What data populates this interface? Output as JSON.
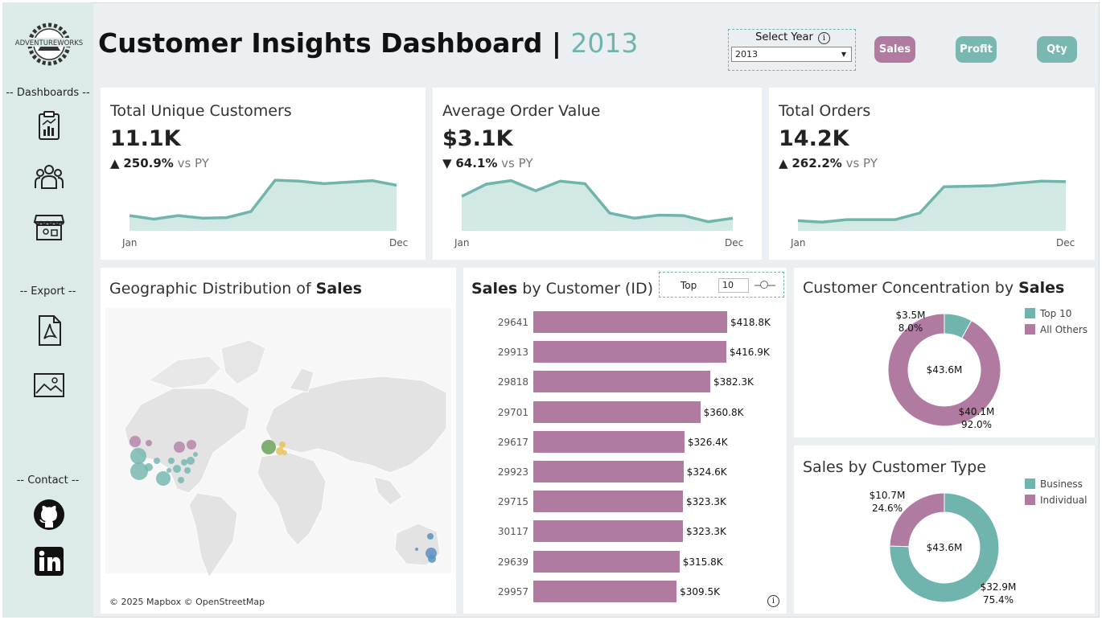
{
  "app": {
    "logo_text": "ADVENTUREWORKS",
    "title": "Customer Insights Dashboard |",
    "year": "2013"
  },
  "sidebar": {
    "dashboards_label": "-- Dashboards --",
    "export_label": "-- Export --",
    "contact_label": "-- Contact --",
    "icons": [
      "report-icon",
      "customers-icon",
      "store-icon",
      "pdf-icon",
      "image-icon",
      "github-icon",
      "linkedin-icon"
    ]
  },
  "filter": {
    "label": "Select Year",
    "value": "2013"
  },
  "measures": {
    "sales": "Sales",
    "profit": "Profit",
    "qty": "Qty"
  },
  "colors": {
    "teal": "#6fb5ad",
    "mauve": "#b07aa1",
    "active_pill": "#b07aa1"
  },
  "kpis": [
    {
      "title": "Total Unique Customers",
      "value": "11.1K",
      "arrow": "▲",
      "delta": "250.9%",
      "vs": "vs PY",
      "start": "Jan",
      "end": "Dec",
      "chart_data": {
        "type": "area",
        "x": [
          "Jan",
          "Feb",
          "Mar",
          "Apr",
          "May",
          "Jun",
          "Jul",
          "Aug",
          "Sep",
          "Oct",
          "Nov",
          "Dec"
        ],
        "values": [
          0.3,
          0.23,
          0.3,
          0.25,
          0.26,
          0.38,
          1.0,
          0.98,
          0.93,
          0.96,
          0.99,
          0.9
        ]
      }
    },
    {
      "title": "Average Order Value",
      "value": "$3.1K",
      "arrow": "▼",
      "delta": "64.1%",
      "vs": "vs PY",
      "start": "Jan",
      "end": "Dec",
      "chart_data": {
        "type": "area",
        "x": [
          "Jan",
          "Feb",
          "Mar",
          "Apr",
          "May",
          "Jun",
          "Jul",
          "Aug",
          "Sep",
          "Oct",
          "Nov",
          "Dec"
        ],
        "values": [
          0.68,
          0.92,
          0.99,
          0.79,
          0.98,
          0.93,
          0.35,
          0.25,
          0.31,
          0.3,
          0.18,
          0.25
        ]
      }
    },
    {
      "title": "Total Orders",
      "value": "14.2K",
      "arrow": "▲",
      "delta": "262.2%",
      "vs": "vs PY",
      "start": "Jan",
      "end": "Dec",
      "chart_data": {
        "type": "area",
        "x": [
          "Jan",
          "Feb",
          "Mar",
          "Apr",
          "May",
          "Jun",
          "Jul",
          "Aug",
          "Sep",
          "Oct",
          "Nov",
          "Dec"
        ],
        "values": [
          0.2,
          0.17,
          0.22,
          0.22,
          0.22,
          0.35,
          0.87,
          0.88,
          0.89,
          0.94,
          0.98,
          0.97
        ]
      }
    }
  ],
  "map": {
    "title_pre": "Geographic Distribution of ",
    "title_bold": "Sales",
    "attribution": "© 2025 Mapbox  © OpenStreetMap"
  },
  "bars": {
    "title_bold": "Sales",
    "title_rest": " by Customer (ID)",
    "top_label": "Top",
    "top_value": "10",
    "chart_data": {
      "type": "bar",
      "categories": [
        "29641",
        "29913",
        "29818",
        "29701",
        "29617",
        "29923",
        "29715",
        "30117",
        "29639",
        "29957"
      ],
      "values": [
        418.8,
        416.9,
        382.3,
        360.8,
        326.4,
        324.6,
        323.3,
        323.3,
        315.8,
        309.5
      ],
      "labels": [
        "$418.8K",
        "$416.9K",
        "$382.3K",
        "$360.8K",
        "$326.4K",
        "$324.6K",
        "$323.3K",
        "$323.3K",
        "$315.8K",
        "$309.5K"
      ]
    }
  },
  "concentration": {
    "title_pre": "Customer Concentration by ",
    "title_bold": "Sales",
    "center": "$43.6M",
    "chart_data": {
      "type": "pie",
      "series": [
        {
          "name": "Top 10",
          "value": 3.5,
          "label": "$3.5M",
          "pct": "8.0%",
          "color": "#6fb5ad"
        },
        {
          "name": "All Others",
          "value": 40.1,
          "label": "$40.1M",
          "pct": "92.0%",
          "color": "#b07aa1"
        }
      ]
    }
  },
  "custtype": {
    "title": "Sales by Customer Type",
    "center": "$43.6M",
    "chart_data": {
      "type": "pie",
      "series": [
        {
          "name": "Business",
          "value": 32.9,
          "label": "$32.9M",
          "pct": "75.4%",
          "color": "#6fb5ad"
        },
        {
          "name": "Individual",
          "value": 10.7,
          "label": "$10.7M",
          "pct": "24.6%",
          "color": "#b07aa1"
        }
      ]
    }
  }
}
